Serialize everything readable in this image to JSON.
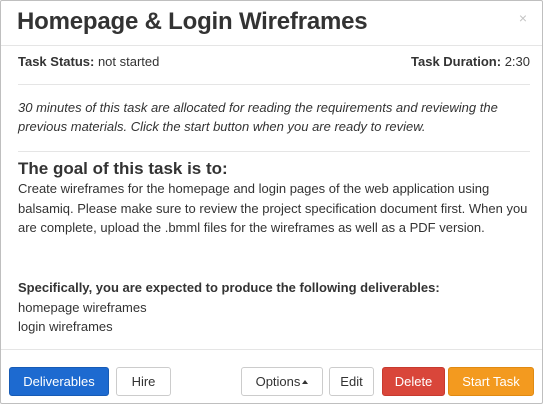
{
  "modal": {
    "title": "Homepage & Login Wireframes",
    "close_icon": "×"
  },
  "status": {
    "status_label": "Task Status:",
    "status_value": " not started",
    "duration_label": "Task Duration:",
    "duration_value": " 2:30"
  },
  "note": "30 minutes of this task are allocated for reading the requirements and reviewing the previous materials. Click the start button when you are ready to review.",
  "goal": {
    "heading": "The goal of this task is to:",
    "text": "Create wireframes for the homepage and login pages of the web application using balsamiq. Please make sure to review the project specification document first. When you are complete, upload the .bmml files for the wireframes as well as a PDF version."
  },
  "deliverables": {
    "heading": "Specifically, you are expected to produce the following deliverables:",
    "items": [
      "homepage wireframes",
      "login wireframes"
    ]
  },
  "footer": {
    "deliverables_label": "Deliverables",
    "hire_label": "Hire",
    "options_label": "Options",
    "edit_label": "Edit",
    "delete_label": "Delete",
    "start_label": "Start Task"
  },
  "colors": {
    "primary": "#1d6ad0",
    "danger": "#d9463a",
    "warning": "#f39a1f"
  }
}
